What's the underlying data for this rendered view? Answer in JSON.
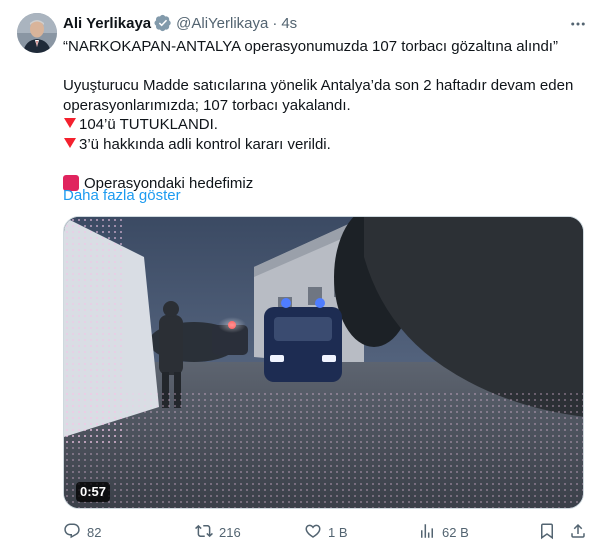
{
  "author": {
    "name": "Ali Yerlikaya",
    "handle": "@AliYerlikaya",
    "separator": "·",
    "time": "4s"
  },
  "tweet": {
    "headline": "“NARKOKAPAN-ANTALYA operasyonumuzda 107 torbacı gözaltına alındı”",
    "body_line1": "Uyuşturucu Madde satıcılarına yönelik Antalya’da son 2 haftadır devam eden",
    "body_line2": "operasyonlarımızda; 107 torbacı yakalandı.",
    "bullet1": "104’ü TUTUKLANDI.",
    "bullet2": "3’ü hakkında adli kontrol kararı verildi.",
    "target_line": "Operasyondaki hedefimiz",
    "show_more": "Daha fazla göster"
  },
  "media": {
    "duration": "0:57"
  },
  "actions": {
    "replies": "82",
    "reposts": "216",
    "likes": "1 B",
    "views": "62 B"
  },
  "colors": {
    "accent": "#1d9bf0",
    "text_secondary": "#536471",
    "alert_red": "#f4212e"
  },
  "icons": [
    "verified-badge-icon",
    "more-icon",
    "reply-icon",
    "repost-icon",
    "like-icon",
    "views-icon",
    "bookmark-icon",
    "share-icon"
  ]
}
